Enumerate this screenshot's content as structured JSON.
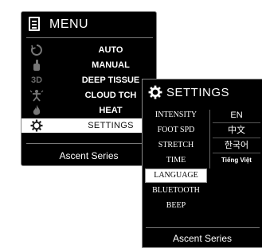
{
  "menu": {
    "title": "MENU",
    "items": [
      {
        "icon": "auto-cycle-icon",
        "label": "AUTO"
      },
      {
        "icon": "hand-icon",
        "label": "MANUAL"
      },
      {
        "icon": "3d-icon",
        "icon_text": "3D",
        "label": "DEEP TISSUE"
      },
      {
        "icon": "cloud-touch-icon",
        "label": "CLOUD TCH"
      },
      {
        "icon": "flame-icon",
        "label": "HEAT"
      },
      {
        "icon": "gear-icon",
        "label": "SETTINGS",
        "selected": true
      }
    ],
    "footer": "Ascent Series"
  },
  "settings": {
    "title": "SETTINGS",
    "items": [
      {
        "label": "INTENSITY"
      },
      {
        "label": "FOOT SPD"
      },
      {
        "label": "STRETCH"
      },
      {
        "label": "TIME"
      },
      {
        "label": "LANGUAGE",
        "selected": true
      },
      {
        "label": "BLUETOOTH"
      },
      {
        "label": "BEEP"
      }
    ],
    "languages": [
      "EN",
      "中文",
      "한국어",
      "Tiếng Việt"
    ],
    "footer": "Ascent Series"
  }
}
